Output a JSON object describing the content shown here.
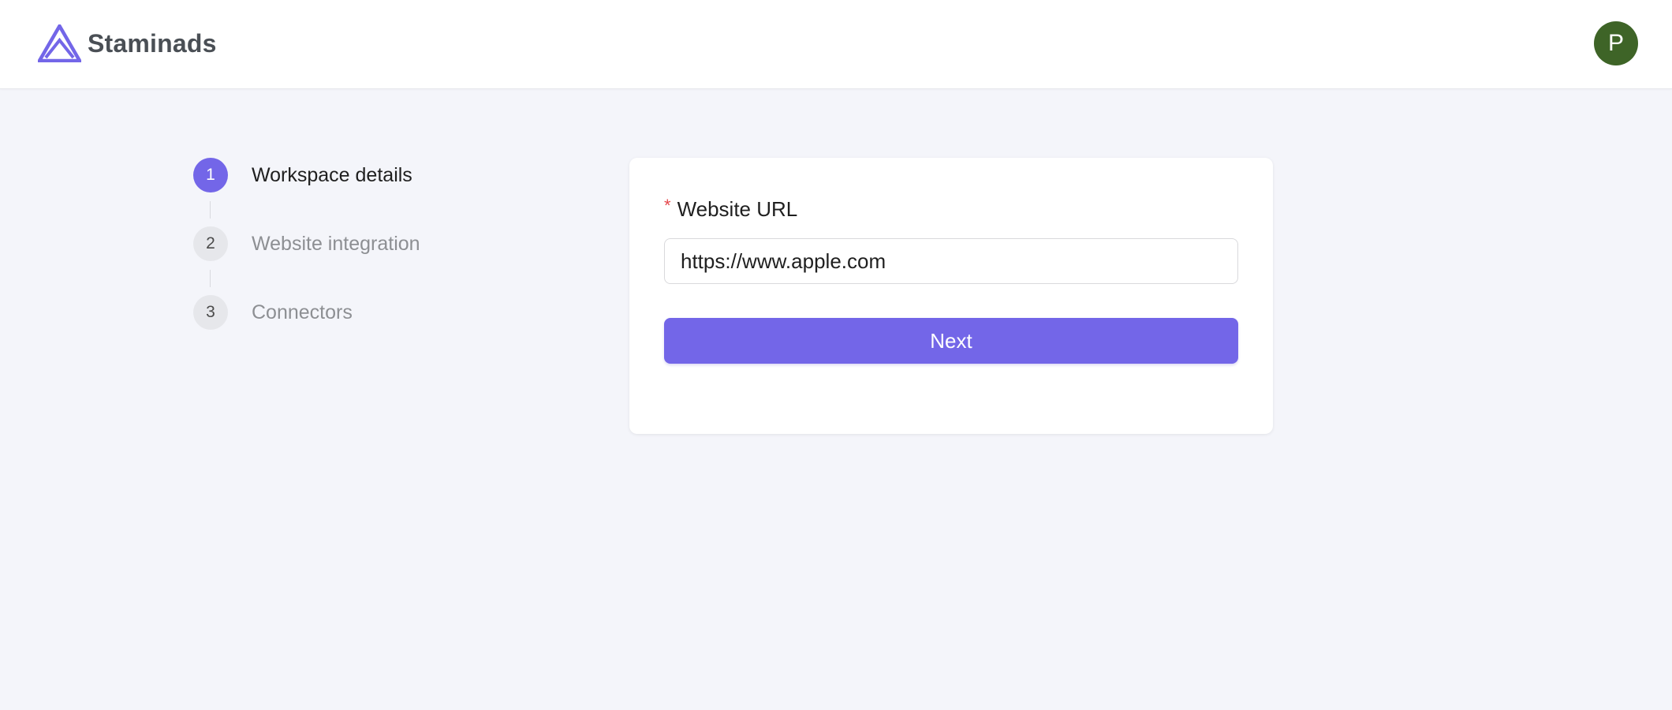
{
  "header": {
    "brand_name": "Staminads",
    "logo_icon": "triangle-logo-icon",
    "avatar_initial": "P",
    "avatar_color": "#3e6427"
  },
  "steps": [
    {
      "number": "1",
      "label": "Workspace details",
      "state": "active"
    },
    {
      "number": "2",
      "label": "Website integration",
      "state": "inactive"
    },
    {
      "number": "3",
      "label": "Connectors",
      "state": "inactive"
    }
  ],
  "form": {
    "required_mark": "*",
    "url_label": "Website URL",
    "url_value": "https://www.apple.com",
    "next_label": "Next"
  },
  "colors": {
    "accent": "#7366e8",
    "required": "#e5484d",
    "background": "#f4f5fa"
  }
}
